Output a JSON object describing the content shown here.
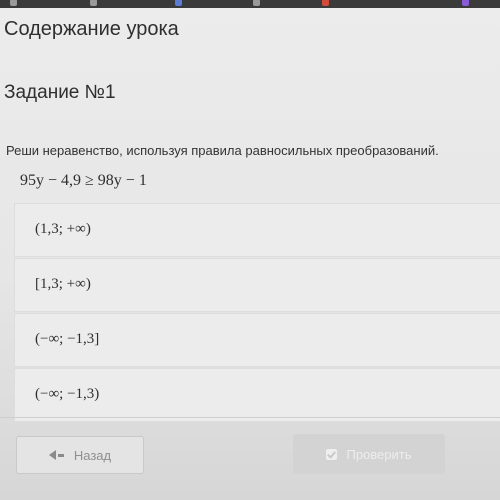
{
  "browser": {
    "bookmarks": [
      {
        "label": "",
        "icon": "bookmark-icon",
        "color": "#9a9a9a"
      },
      {
        "label": "",
        "icon": "bookmark-icon",
        "color": "#9a9a9a"
      },
      {
        "label": "",
        "icon": "bookmark-icon",
        "color": "#5b7bd5"
      },
      {
        "label": "",
        "icon": "bookmark-icon",
        "color": "#9a9a9a"
      },
      {
        "label": "",
        "icon": "bookmark-icon",
        "color": "#d24a3a"
      },
      {
        "label": "",
        "icon": "bookmark-icon",
        "color": "#8a5bd6"
      }
    ]
  },
  "page": {
    "heading": "Содержание урока",
    "task_title": "Задание №1",
    "instruction": "Реши неравенство, используя правила равносильных преобразований.",
    "equation": "95y − 4,9 ≥ 98y − 1"
  },
  "options": [
    {
      "label": "(1,3; +∞)"
    },
    {
      "label": "[1,3; +∞)"
    },
    {
      "label": "(−∞; −1,3]"
    },
    {
      "label": "(−∞; −1,3)"
    }
  ],
  "footer": {
    "back_label": "Назад",
    "check_label": "Проверить"
  },
  "colors": {
    "background": "#e6e6e6",
    "disabled_button": "#d3d3d3",
    "text": "#2f2f2f"
  }
}
